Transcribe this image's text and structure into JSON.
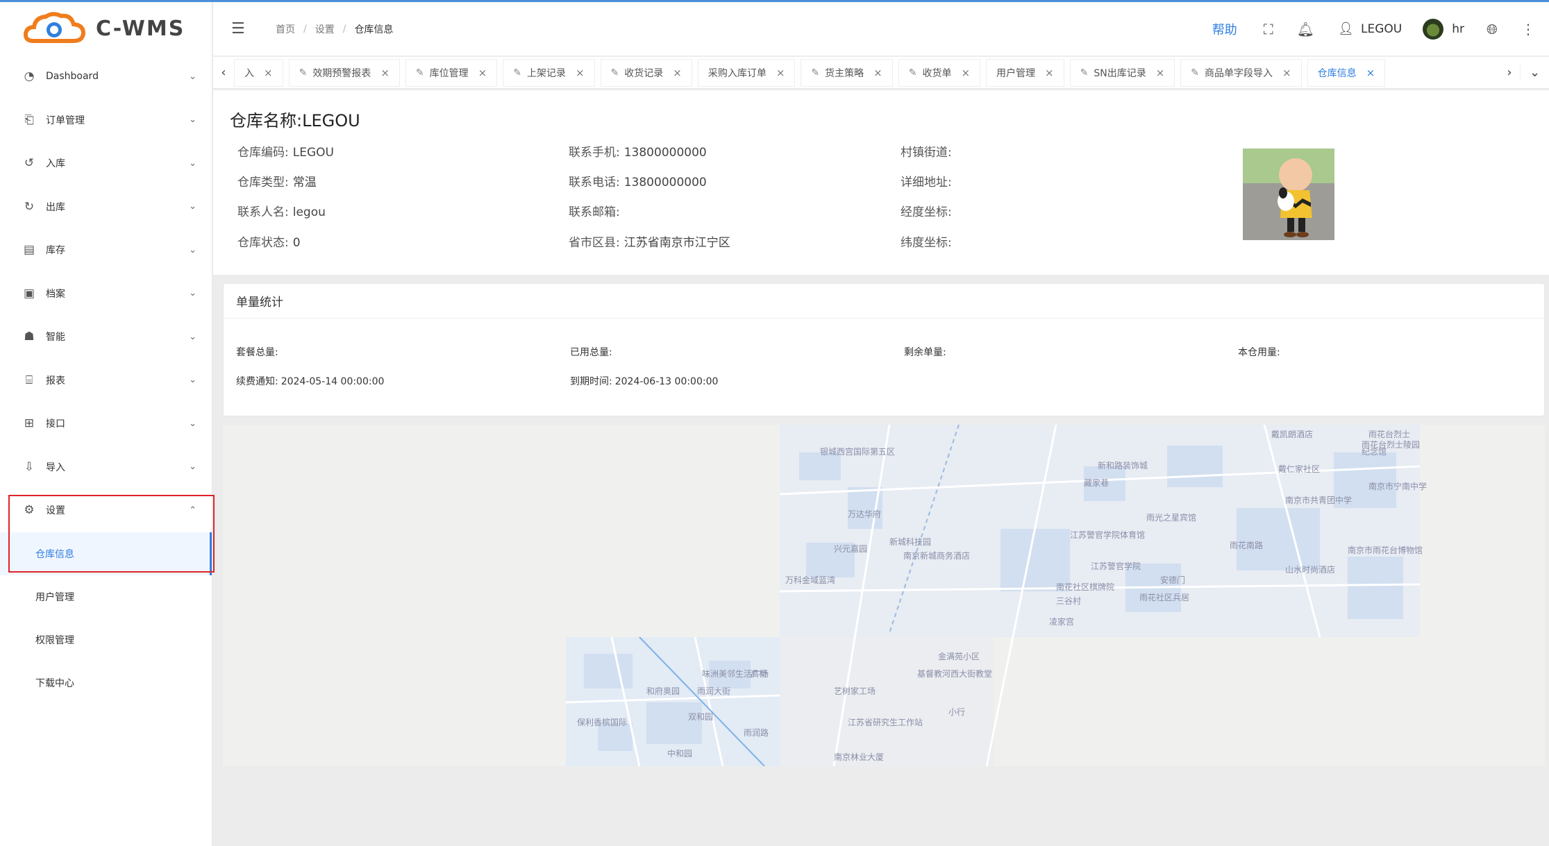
{
  "app": {
    "logo_text": "C-WMS"
  },
  "sidebar": {
    "items": [
      {
        "label": "Dashboard",
        "icon": "dashboard-icon"
      },
      {
        "label": "订单管理",
        "icon": "order-icon"
      },
      {
        "label": "入库",
        "icon": "inbound-icon"
      },
      {
        "label": "出库",
        "icon": "outbound-icon"
      },
      {
        "label": "库存",
        "icon": "stock-icon"
      },
      {
        "label": "档案",
        "icon": "archive-icon"
      },
      {
        "label": "智能",
        "icon": "robot-icon"
      },
      {
        "label": "报表",
        "icon": "report-icon"
      },
      {
        "label": "接口",
        "icon": "api-icon"
      },
      {
        "label": "导入",
        "icon": "import-icon"
      },
      {
        "label": "设置",
        "icon": "gear-icon"
      }
    ],
    "settings_sub": [
      {
        "label": "仓库信息",
        "active": true
      },
      {
        "label": "用户管理",
        "active": false
      },
      {
        "label": "权限管理",
        "active": false
      },
      {
        "label": "下载中心",
        "active": false
      }
    ]
  },
  "header": {
    "breadcrumb": [
      "首页",
      "设置",
      "仓库信息"
    ],
    "help": "帮助",
    "user": "LEGOU",
    "account": "hr"
  },
  "tabs": [
    {
      "label": "入",
      "closable": true,
      "icon": false
    },
    {
      "label": "效期预警报表",
      "icon": true
    },
    {
      "label": "库位管理",
      "icon": true
    },
    {
      "label": "上架记录",
      "icon": true
    },
    {
      "label": "收货记录",
      "icon": true
    },
    {
      "label": "采购入库订单",
      "icon": false
    },
    {
      "label": "货主策略",
      "icon": true
    },
    {
      "label": "收货单",
      "icon": true
    },
    {
      "label": "用户管理",
      "icon": false
    },
    {
      "label": "SN出库记录",
      "icon": true
    },
    {
      "label": "商品单字段导入",
      "icon": true
    },
    {
      "label": "仓库信息",
      "icon": false,
      "active": true
    }
  ],
  "warehouse": {
    "title": "仓库名称:LEGOU",
    "fields": [
      {
        "label": "仓库编码:",
        "value": "LEGOU"
      },
      {
        "label": "仓库类型:",
        "value": "常温"
      },
      {
        "label": "联系人名:",
        "value": "legou"
      },
      {
        "label": "仓库状态:",
        "value": "0"
      },
      {
        "label": "联系手机:",
        "value": "13800000000"
      },
      {
        "label": "联系电话:",
        "value": "13800000000"
      },
      {
        "label": "联系邮箱:",
        "value": ""
      },
      {
        "label": "省市区县:",
        "value": "江苏省南京市江宁区"
      },
      {
        "label": "村镇街道:",
        "value": ""
      },
      {
        "label": "详细地址:",
        "value": ""
      },
      {
        "label": "经度坐标:",
        "value": ""
      },
      {
        "label": "纬度坐标:",
        "value": ""
      }
    ]
  },
  "stats": {
    "title": "单量统计",
    "items": [
      {
        "label": "套餐总量:",
        "value": ""
      },
      {
        "label": "已用总量:",
        "value": ""
      },
      {
        "label": "剩余单量:",
        "value": ""
      },
      {
        "label": "本仓用量:",
        "value": ""
      },
      {
        "label": "续费通知:",
        "value": "2024-05-14 00:00:00"
      },
      {
        "label": "到期时间:",
        "value": "2024-06-13 00:00:00"
      }
    ]
  },
  "map": {
    "labels": [
      "银城西宫国际第五区",
      "新和路装饰城",
      "戴凯朗酒店",
      "雨花台烈士陵园",
      "藏家巷",
      "戴仁家社区",
      "万达华府",
      "雨光之星宾馆",
      "南京市共青团中学",
      "新城科技园",
      "江苏警官学院体育馆",
      "南京新城商务酒店",
      "兴元嘉园",
      "江苏警官学院",
      "雨花南路",
      "南京市雨花台博物馆",
      "万科金域蓝湾",
      "南花社区棋牌院",
      "安德门",
      "山水时尚酒店",
      "雨花社区兵居",
      "三谷村",
      "凌家宫",
      "金满苑小区",
      "味洲美邻生活广场",
      "高桥",
      "基督教河西大街教堂",
      "和府奥园",
      "雨润大街",
      "艺树家工场",
      "小行",
      "双和园",
      "保利香槟国际",
      "江苏省研究生工作站",
      "雨润路",
      "中和园",
      "南京林业大厦",
      "雨花台烈士",
      "纪念馆",
      "南京市宁南中学"
    ]
  }
}
